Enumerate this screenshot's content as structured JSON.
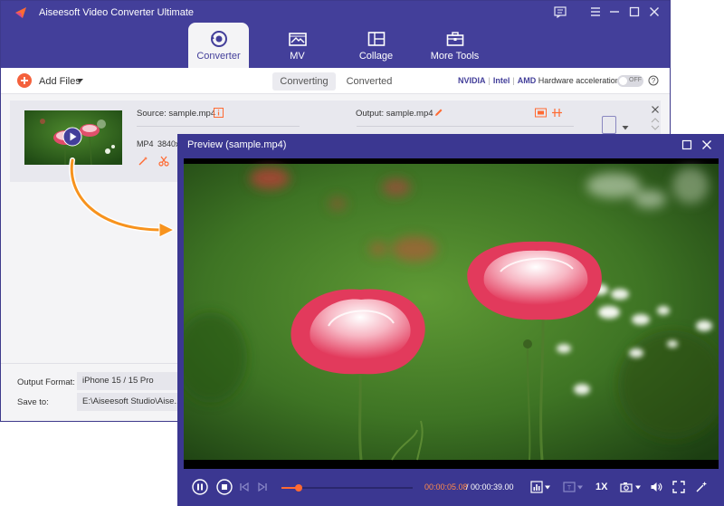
{
  "app": {
    "title": "Aiseesoft Video Converter Ultimate",
    "accent": "#433f9a",
    "tabs": [
      {
        "label": "Converter",
        "icon": "converter-icon",
        "active": true
      },
      {
        "label": "MV",
        "icon": "mv-icon",
        "active": false
      },
      {
        "label": "Collage",
        "icon": "collage-icon",
        "active": false
      },
      {
        "label": "More Tools",
        "icon": "toolbox-icon",
        "active": false
      }
    ]
  },
  "toolbar": {
    "add_files": "Add Files",
    "segments": [
      "Converting",
      "Converted"
    ],
    "hw": {
      "nvidia": "NVIDIA",
      "intel": "Intel",
      "amd": "AMD",
      "label": "Hardware acceleration",
      "toggle": "OFF"
    }
  },
  "file": {
    "source": "Source: sample.mp4",
    "output": "Output: sample.mp4",
    "format": "MP4",
    "resolution": "3840x"
  },
  "bottom": {
    "output_format_label": "Output Format:",
    "output_format_value": "iPhone 15 / 15 Pro",
    "save_to_label": "Save to:",
    "save_to_value": "E:\\Aiseesoft Studio\\Aise...er"
  },
  "preview": {
    "title": "Preview (sample.mp4)",
    "time_current": "00:00:05.08",
    "time_total": "/ 00:00:39.00",
    "progress": 0.13,
    "speed": "1X",
    "progress_color": "#ff6a32"
  }
}
